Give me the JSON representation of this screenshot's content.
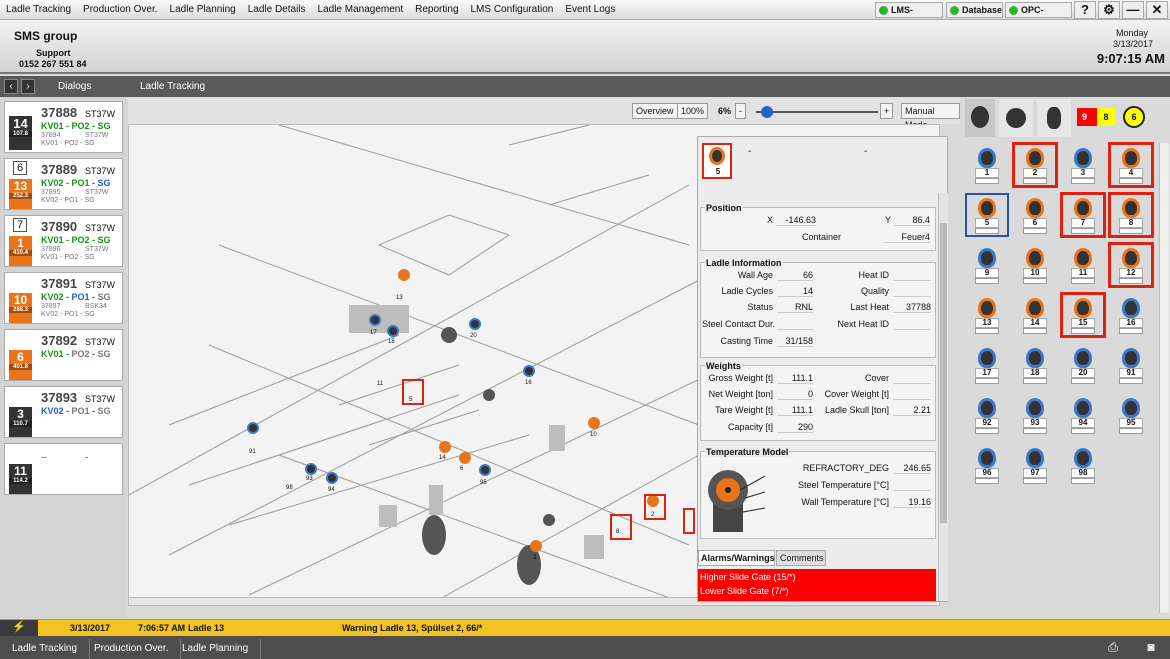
{
  "menu": [
    "Ladle Tracking",
    "Production Over.",
    "Ladle Planning",
    "Ladle Details",
    "Ladle Management",
    "Reporting",
    "LMS Configuration",
    "Event Logs"
  ],
  "servers": {
    "lms": "LMS-Server",
    "db": "Database",
    "opc": "OPC-Server"
  },
  "icons": {
    "help": "?",
    "settings": "gear-icon",
    "minimize": "—",
    "close": "✕"
  },
  "brand": {
    "logo": "SMS group",
    "support_label": "Support",
    "phone": "0152 267 551 84"
  },
  "clock": {
    "day": "Monday",
    "date": "3/13/2017",
    "time": "9:07:15 AM"
  },
  "breadcrumb": {
    "dialogs": "Dialogs",
    "current": "Ladle Tracking"
  },
  "toolbar": {
    "overview": "Overview",
    "pct100": "100%",
    "zoom": "6%",
    "minus": "-",
    "plus": "+",
    "manual": "Manual Mode"
  },
  "ladles_list": [
    {
      "heat": "37888",
      "grade": "ST37W",
      "route_a": "KV01",
      "route_b": "PO2",
      "route_c": "SG",
      "prev_heat": "37894",
      "prev_grade": "ST37W",
      "prev_route": "KV01 - PO2 - SG",
      "ladle": "14",
      "temp": "107.8"
    },
    {
      "heat": "37889",
      "grade": "ST37W",
      "route_a": "KV02",
      "route_b": "PO1",
      "route_c": "SG",
      "prev_heat": "37895",
      "prev_grade": "ST37W",
      "prev_route": "KV02 - PO1 - SG",
      "ladle": "13",
      "temp": "252.3",
      "top": "6"
    },
    {
      "heat": "37890",
      "grade": "ST37W",
      "route_a": "KV01",
      "route_b": "PO2",
      "route_c": "SG",
      "prev_heat": "37896",
      "prev_grade": "ST37W",
      "prev_route": "KV01 - PO2 - SG",
      "ladle": "1",
      "temp": "410.4",
      "top": "7"
    },
    {
      "heat": "37891",
      "grade": "ST37W",
      "route_a": "KV02",
      "route_b": "PO1",
      "route_c": "SG",
      "prev_heat": "37897",
      "prev_grade": "BSK34",
      "prev_route": "KV02 - PO1 - SG",
      "ladle": "10",
      "temp": "288.3"
    },
    {
      "heat": "37892",
      "grade": "ST37W",
      "route_a": "KV01",
      "route_b": "PO2",
      "route_c": "SG",
      "ladle": "6",
      "temp": "401.8"
    },
    {
      "heat": "37893",
      "grade": "ST37W",
      "route_a": "KV02",
      "route_b": "PO1",
      "route_c": "SG",
      "ladle": "3",
      "temp": "110.7"
    },
    {
      "heat": "--",
      "grade": "-",
      "ladle": "11",
      "temp": "114.2"
    }
  ],
  "detail": {
    "ladle": "5",
    "dash1": "-",
    "dash2": "-",
    "position": {
      "title": "Position",
      "x_label": "X",
      "x": "-146.63",
      "y_label": "Y",
      "y": "86.4",
      "container_label": "Container",
      "container": "Feuer4"
    },
    "info": {
      "title": "Ladle Information",
      "wall_age_l": "Wall Age",
      "wall_age": "66",
      "cycles_l": "Ladle Cycles",
      "cycles": "14",
      "status_l": "Status",
      "status": "RNL",
      "contact_l": "Steel Contact Dur.",
      "casting_l": "Casting Time",
      "casting": "31/158",
      "heat_id_l": "Heat ID",
      "quality_l": "Quality",
      "last_heat_l": "Last Heat",
      "last_heat": "37788",
      "next_heat_l": "Next Heat ID"
    },
    "weights": {
      "title": "Weights",
      "gross_l": "Gross Weight [t]",
      "gross": "111.1",
      "net_l": "Net Weight [ton]",
      "net": "0",
      "tare_l": "Tare Weight [t]",
      "tare": "111.1",
      "cap_l": "Capacity [t]",
      "cap": "290",
      "cover_l": "Cover",
      "cover_w_l": "Cover Weight [t]",
      "skull_l": "Ladle Skull [ton]",
      "skull": "2.21"
    },
    "temp": {
      "title": "Temperature Model",
      "refr_l": "REFRACTORY_DEG",
      "refr": "246.65",
      "steel_l": "Steel Temperature [°C]",
      "wall_l": "Wall Temperature [°C]",
      "wall": "19.16"
    },
    "tabs": {
      "alarms": "Alarms/Warnings",
      "comments": "Comments"
    },
    "alarms": [
      "Higher Slide Gate (15/*)",
      "Lower Slide Gate (7/*)"
    ]
  },
  "right_tabs": {
    "badge_red": "9",
    "badge_yellow": "8",
    "badge_clock": "6"
  },
  "grid": [
    "1",
    "2",
    "3",
    "4",
    "5",
    "6",
    "7",
    "8",
    "9",
    "10",
    "11",
    "12",
    "13",
    "14",
    "15",
    "16",
    "17",
    "18",
    "20",
    "91",
    "92",
    "93",
    "94",
    "95",
    "96",
    "97",
    "98"
  ],
  "status": {
    "date": "3/13/2017",
    "time": "7:06:57 AM",
    "ladle": "Ladle 13",
    "message": "Warning Ladle 13, Spülset 2, 66/*"
  },
  "bottom_tabs": [
    "Ladle Tracking",
    "Production Over.",
    "Ladle Planning"
  ],
  "map_labels": [
    "13",
    "17",
    "18",
    "20",
    "11",
    "5",
    "16",
    "10",
    "14",
    "6",
    "95",
    "91",
    "94",
    "93",
    "98",
    "2",
    "8",
    "3"
  ]
}
